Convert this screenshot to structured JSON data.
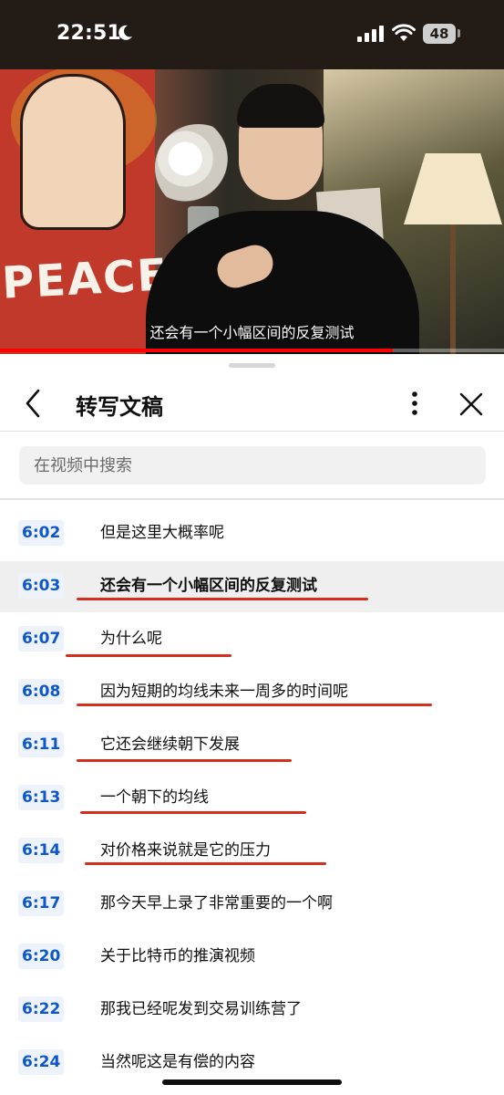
{
  "status_bar": {
    "time": "22:51",
    "battery": "48"
  },
  "video": {
    "subtitle": "还会有一个小幅区间的反复测试",
    "mural_text": "PEACE",
    "progress": 0.78
  },
  "transcript_panel": {
    "title": "转写文稿",
    "search_placeholder": "在视频中搜索",
    "segments": [
      {
        "time": "6:02",
        "text": "但是这里大概率呢"
      },
      {
        "time": "6:03",
        "text": "还会有一个小幅区间的反复测试"
      },
      {
        "time": "6:07",
        "text": "为什么呢"
      },
      {
        "time": "6:08",
        "text": "因为短期的均线未来一周多的时间呢"
      },
      {
        "time": "6:11",
        "text": "它还会继续朝下发展"
      },
      {
        "time": "6:13",
        "text": "一个朝下的均线"
      },
      {
        "time": "6:14",
        "text": "对价格来说就是它的压力"
      },
      {
        "time": "6:17",
        "text": "那今天早上录了非常重要的一个啊"
      },
      {
        "time": "6:20",
        "text": "关于比特币的推演视频"
      },
      {
        "time": "6:22",
        "text": "那我已经呢发到交易训练营了"
      },
      {
        "time": "6:24",
        "text": "当然呢这是有偿的内容"
      }
    ]
  },
  "colors": {
    "timestamp": "#0b57d0",
    "annotation_underline": "#d32f1f",
    "progress": "#ff0000"
  }
}
